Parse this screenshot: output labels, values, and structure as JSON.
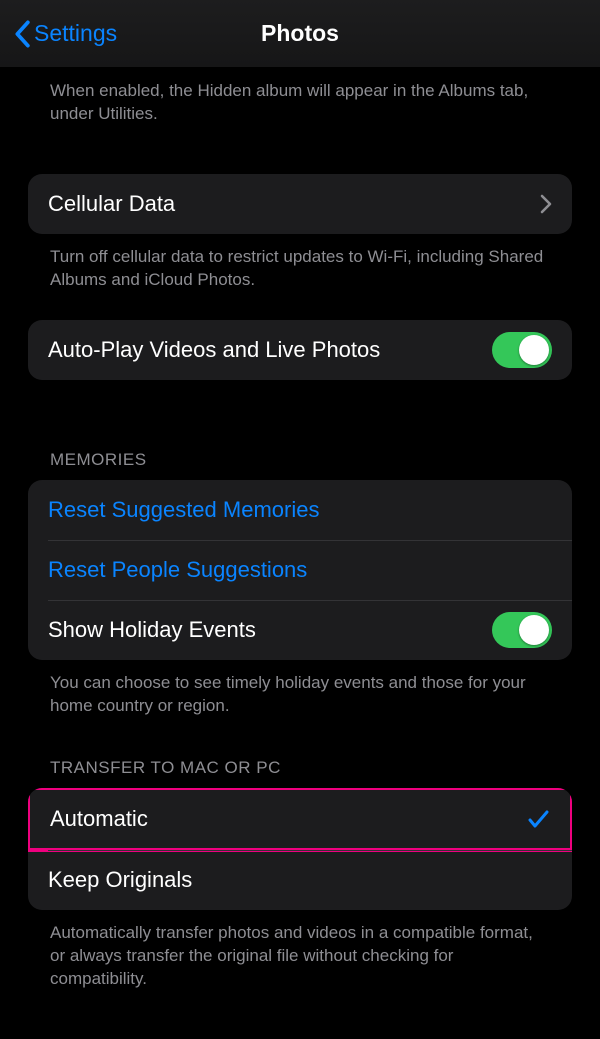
{
  "nav": {
    "back_label": "Settings",
    "title": "Photos"
  },
  "hidden_footer": "When enabled, the Hidden album will appear in the Albums tab, under Utilities.",
  "cellular": {
    "label": "Cellular Data",
    "footer": "Turn off cellular data to restrict updates to Wi-Fi, including Shared Albums and iCloud Photos."
  },
  "autoplay": {
    "label": "Auto-Play Videos and Live Photos"
  },
  "memories": {
    "header": "MEMORIES",
    "reset_suggested": "Reset Suggested Memories",
    "reset_people": "Reset People Suggestions",
    "holiday": "Show Holiday Events",
    "footer": "You can choose to see timely holiday events and those for your home country or region."
  },
  "transfer": {
    "header": "TRANSFER TO MAC OR PC",
    "automatic": "Automatic",
    "keep_originals": "Keep Originals",
    "footer": "Automatically transfer photos and videos in a compatible format, or always transfer the original file without checking for compatibility."
  }
}
